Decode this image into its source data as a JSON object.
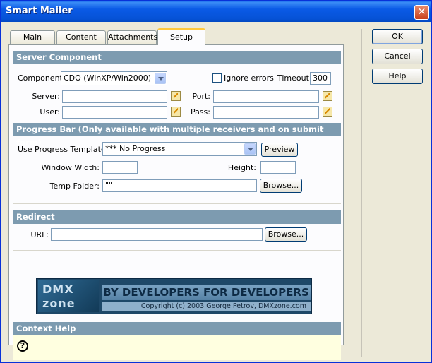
{
  "window": {
    "title": "Smart Mailer",
    "close_icon": "close-icon"
  },
  "tabs": [
    {
      "label": "Main",
      "active": false
    },
    {
      "label": "Content",
      "active": false
    },
    {
      "label": "Attachments",
      "active": false
    },
    {
      "label": "Setup",
      "active": true
    }
  ],
  "server": {
    "header": "Server Component",
    "component_label": "Component:",
    "component_value": "CDO (WinXP/Win2000)",
    "ignore_errors_label": "Ignore errors",
    "ignore_errors_checked": false,
    "timeout_label": "Timeout:",
    "timeout_value": "300",
    "server_label": "Server:",
    "server_value": "",
    "port_label": "Port:",
    "port_value": "",
    "user_label": "User:",
    "user_value": "",
    "pass_label": "Pass:",
    "pass_value": ""
  },
  "progress": {
    "header": "Progress Bar (Only available with multiple receivers and on submit form)",
    "template_label": "Use Progress Template:",
    "template_value": "*** No Progress",
    "preview_label": "Preview",
    "width_label": "Window Width:",
    "width_value": "",
    "height_label": "Height:",
    "height_value": "",
    "temp_label": "Temp Folder:",
    "temp_value": "\"\"",
    "browse_label": "Browse..."
  },
  "redirect": {
    "header": "Redirect",
    "url_label": "URL:",
    "url_value": "",
    "browse_label": "Browse..."
  },
  "banner": {
    "logo_text": "DMX zone",
    "headline": "BY DEVELOPERS FOR DEVELOPERS",
    "copyright": "Copyright (c) 2003 George Petrov, DMXzone.com"
  },
  "context_help": {
    "header": "Context Help",
    "icon": "question-circle-icon"
  },
  "buttons": {
    "ok": "OK",
    "cancel": "Cancel",
    "help": "Help"
  }
}
